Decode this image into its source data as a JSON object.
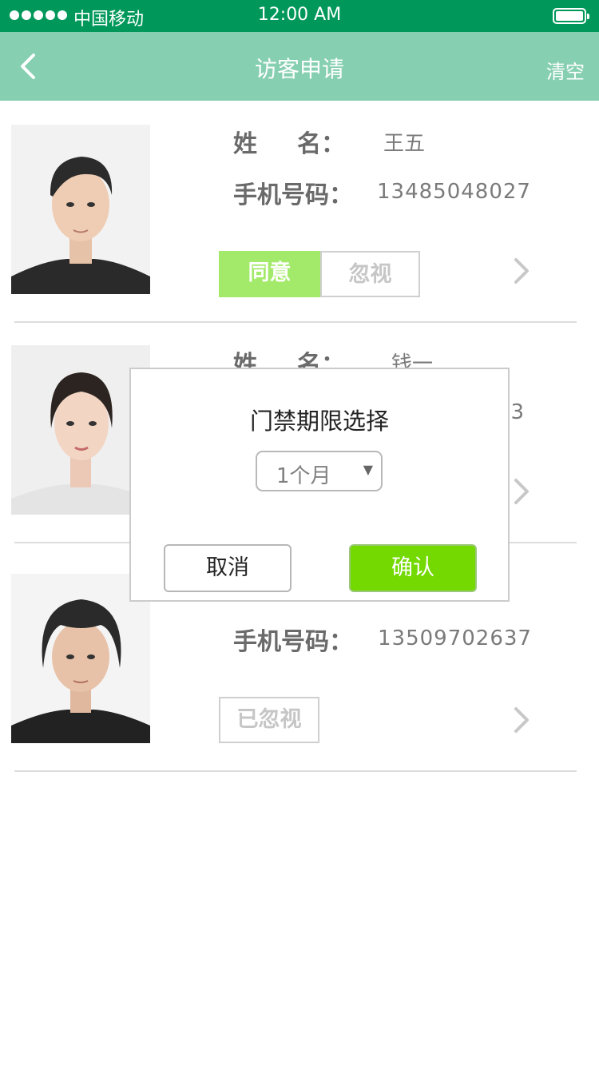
{
  "status_bar": {
    "carrier": "中国移动",
    "time": "12:00 AM"
  },
  "nav": {
    "title": "访客申请",
    "clear_label": "清空"
  },
  "labels": {
    "name_chars": [
      "姓",
      "名："
    ],
    "phone": "手机号码："
  },
  "visitors": [
    {
      "name": "王五",
      "phone": "13485048027",
      "agree_label": "同意",
      "ignore_label": "忽视"
    },
    {
      "name": "钱一",
      "phone_fragment": "53"
    },
    {
      "phone": "13509702637",
      "status_label": "已忽视"
    }
  ],
  "dialog": {
    "title": "门禁期限选择",
    "selected_period": "1个月",
    "cancel_label": "取消",
    "confirm_label": "确认"
  },
  "colors": {
    "status_bar": "#00985a",
    "nav_bar": "#86cfb1",
    "agree_button": "#a3ea6b",
    "confirm_button": "#73d900"
  }
}
